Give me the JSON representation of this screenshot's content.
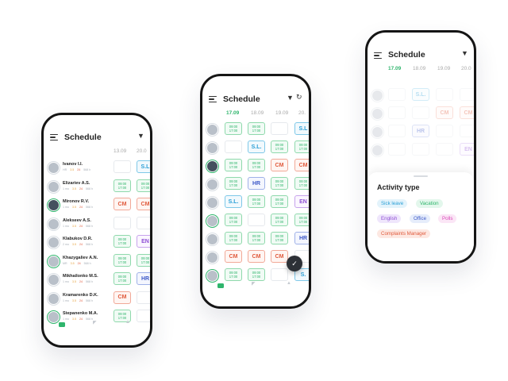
{
  "screens": {
    "left": {
      "title": "Schedule",
      "dates": [
        "13.09",
        "20.0"
      ],
      "people": [
        {
          "name": "Ivanov I.I.",
          "meta_a": "HR",
          "meta_b": "3.5",
          "meta_c": "24",
          "meta_d": "568 h"
        },
        {
          "name": "Elizariev A.S.",
          "meta_a": "1 mo",
          "meta_b": "3.5",
          "meta_c": "24",
          "meta_d": "568 h"
        },
        {
          "name": "Mironov R.V.",
          "meta_a": "1 mo",
          "meta_b": "3.5",
          "meta_c": "24",
          "meta_d": "568 h"
        },
        {
          "name": "Alekseev A.S.",
          "meta_a": "1 mo",
          "meta_b": "3.5",
          "meta_c": "24",
          "meta_d": "568 h"
        },
        {
          "name": "Klabukov D.R.",
          "meta_a": "2 mo",
          "meta_b": "3.5",
          "meta_c": "24",
          "meta_d": "568 h"
        },
        {
          "name": "Khazygaliev A.N.",
          "meta_a": "MR",
          "meta_b": "3.5",
          "meta_c": "24",
          "meta_d": "568 h"
        },
        {
          "name": "Mikhailonko M.S.",
          "meta_a": "1 mo",
          "meta_b": "3.5",
          "meta_c": "24",
          "meta_d": "568 h"
        },
        {
          "name": "Kramarenko D.K.",
          "meta_a": "1 mo",
          "meta_b": "3.5",
          "meta_c": "24",
          "meta_d": "568 h"
        },
        {
          "name": "Stepanenko M.A.",
          "meta_a": "1 mo",
          "meta_b": "3.5",
          "meta_c": "24",
          "meta_d": "568 h"
        }
      ],
      "cells": [
        [
          "",
          "S.L"
        ],
        [
          "09:00\n17:00",
          "09:00\n17:00"
        ],
        [
          "CM",
          "CM"
        ],
        [
          "",
          ""
        ],
        [
          "09:00\n17:00",
          "EN"
        ],
        [
          "09:00\n17:00",
          "09:00\n17:00"
        ],
        [
          "09:00\n17:00",
          "HR"
        ],
        [
          "CM",
          ""
        ],
        [
          "09:00\n17:00",
          ""
        ]
      ]
    },
    "middle": {
      "title": "Schedule",
      "dates": [
        "17.09",
        "18.09",
        "19.09",
        "20."
      ],
      "cells": [
        [
          "09:00\n17:00",
          "09:00\n17:00",
          "",
          "S.L"
        ],
        [
          "",
          "S.L.",
          "09:00\n17:00",
          "09:00\n17:00"
        ],
        [
          "09:00\n17:00",
          "09:00\n17:00",
          "CM",
          "CM"
        ],
        [
          "09:00\n17:00",
          "HR",
          "09:00\n17:00",
          "09:00\n17:00"
        ],
        [
          "S.L.",
          "09:00\n17:00",
          "09:00\n17:00",
          "EN"
        ],
        [
          "09:00\n17:00",
          "",
          "09:00\n17:00",
          "09:00\n17:00"
        ],
        [
          "09:00\n17:00",
          "09:00\n17:00",
          "09:00\n17:00",
          "HR"
        ],
        [
          "CM",
          "CM",
          "CM",
          ""
        ],
        [
          "09:00\n17:00",
          "09:00\n17:00",
          "",
          "S."
        ]
      ]
    },
    "right": {
      "title": "Schedule",
      "dates": [
        "17.09",
        "18.09",
        "19.09",
        "20.0"
      ],
      "faded_cells": [
        [
          "",
          "S.L.",
          "",
          ""
        ],
        [
          "",
          "",
          "CM",
          "CM"
        ],
        [
          "",
          "HR",
          "",
          ""
        ],
        [
          "",
          "",
          "",
          "EN"
        ]
      ],
      "sheet_title": "Activity type",
      "tags": [
        {
          "label": "Sick leave",
          "kind": "sick"
        },
        {
          "label": "Vacation",
          "kind": "vac"
        },
        {
          "label": "English",
          "kind": "eng"
        },
        {
          "label": "Office",
          "kind": "off"
        },
        {
          "label": "Polls",
          "kind": "pol"
        },
        {
          "label": "Complaints Manager",
          "kind": "comp"
        }
      ]
    }
  },
  "icons": {
    "menu": "menu-icon",
    "filter": "filter-icon",
    "refresh": "refresh-icon",
    "check": "check-icon"
  },
  "colors": {
    "accent_green": "#2fb56c",
    "cm_red": "#e05a3c",
    "sl_blue": "#2a9fd6",
    "hr_indigo": "#3c58c8",
    "en_purple": "#8e4ed4"
  }
}
